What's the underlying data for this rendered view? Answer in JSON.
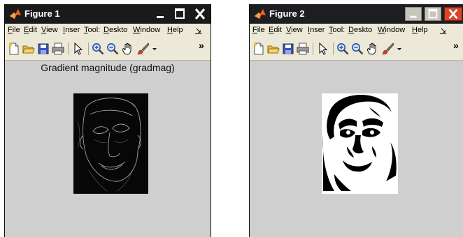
{
  "windows": [
    {
      "title": "Figure 1",
      "menu": [
        "File",
        "Edit",
        "View",
        "Inser",
        "Tool:",
        "Deskto",
        "Window",
        "Help",
        "↘"
      ],
      "toolbar_overflow": "»",
      "plot_title": "Gradient magnitude (gradmag)",
      "image": {
        "kind": "grayscale gradient-magnitude edge image (dark background, light outlines of a face)"
      }
    },
    {
      "title": "Figure 2",
      "menu": [
        "File",
        "Edit",
        "View",
        "Inser",
        "Tool:",
        "Deskto",
        "Window",
        "Help",
        "↘"
      ],
      "toolbar_overflow": "»",
      "plot_title": "",
      "image": {
        "kind": "binary black-and-white thresholded image of a face"
      }
    }
  ],
  "icons": [
    "matlab-logo-icon",
    "minimize-icon",
    "maximize-icon",
    "close-icon",
    "new-figure-icon",
    "open-file-icon",
    "save-icon",
    "print-icon",
    "select-arrow-icon",
    "zoom-in-icon",
    "zoom-out-icon",
    "pan-hand-icon",
    "data-cursor-brush-icon",
    "overflow-chevron-icon"
  ],
  "colors": {
    "titlebar": "#1a1a1a",
    "menubar": "#ece9d8",
    "figure_background": "#cfcfcf",
    "close_button_win2": "#d9452a",
    "matlab_logo_orange": "#e86a1f"
  }
}
